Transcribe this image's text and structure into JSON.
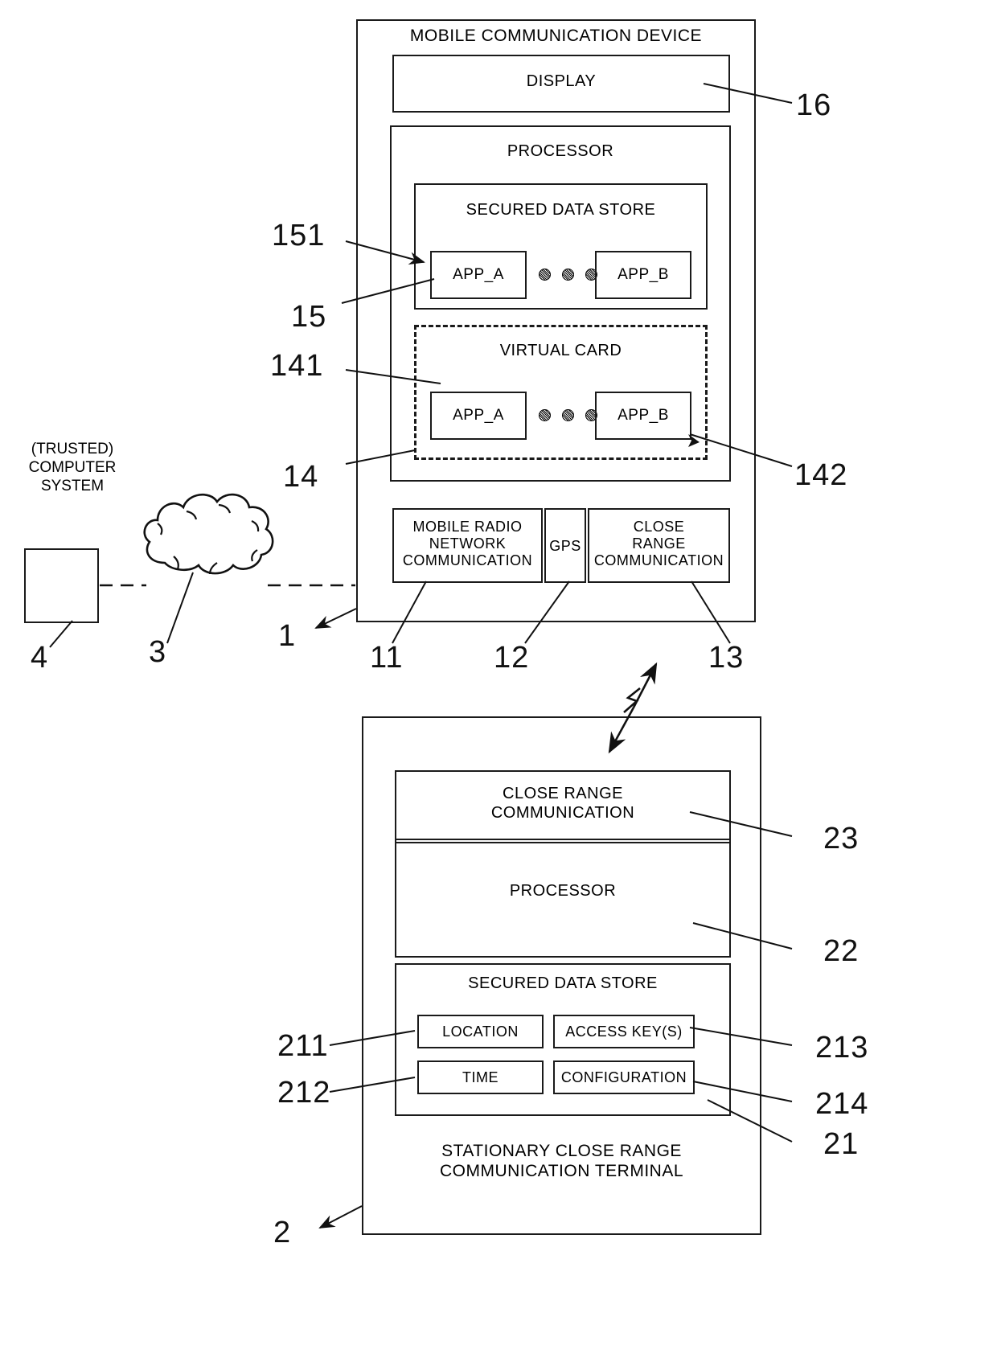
{
  "figure": {
    "type": "patent-block-diagram"
  },
  "mobile_device": {
    "title": "MOBILE COMMUNICATION DEVICE",
    "ref": "1",
    "display": {
      "label": "DISPLAY",
      "ref": "16"
    },
    "processor": {
      "label": "PROCESSOR"
    },
    "secured_data_store": {
      "label": "SECURED DATA STORE",
      "ref": "15",
      "app_a": {
        "label": "APP_A",
        "ref": "151"
      },
      "app_b": {
        "label": "APP_B"
      }
    },
    "virtual_card": {
      "label": "VIRTUAL CARD",
      "ref": "14",
      "app_a": {
        "label": "APP_A",
        "ref": "141"
      },
      "app_b": {
        "label": "APP_B",
        "ref": "142"
      }
    },
    "radio": {
      "label": "MOBILE RADIO\nNETWORK\nCOMMUNICATION",
      "ref": "11"
    },
    "gps": {
      "label": "GPS",
      "ref": "12"
    },
    "close_range": {
      "label": "CLOSE\nRANGE\nCOMMUNICATION",
      "ref": "13"
    }
  },
  "computer_system": {
    "label": "(TRUSTED)\nCOMPUTER\nSYSTEM",
    "ref": "4"
  },
  "network": {
    "label": "",
    "ref": "3"
  },
  "terminal": {
    "title": "STATIONARY CLOSE RANGE\nCOMMUNICATION TERMINAL",
    "ref": "2",
    "close_range": {
      "label": "CLOSE RANGE\nCOMMUNICATION",
      "ref": "23"
    },
    "processor": {
      "label": "PROCESSOR",
      "ref": "22"
    },
    "secured_data_store": {
      "label": "SECURED DATA STORE",
      "ref": "21",
      "location": {
        "label": "LOCATION",
        "ref": "211"
      },
      "time": {
        "label": "TIME",
        "ref": "212"
      },
      "access_keys": {
        "label": "ACCESS KEY(S)",
        "ref": "213"
      },
      "configuration": {
        "label": "CONFIGURATION",
        "ref": "214"
      }
    }
  }
}
